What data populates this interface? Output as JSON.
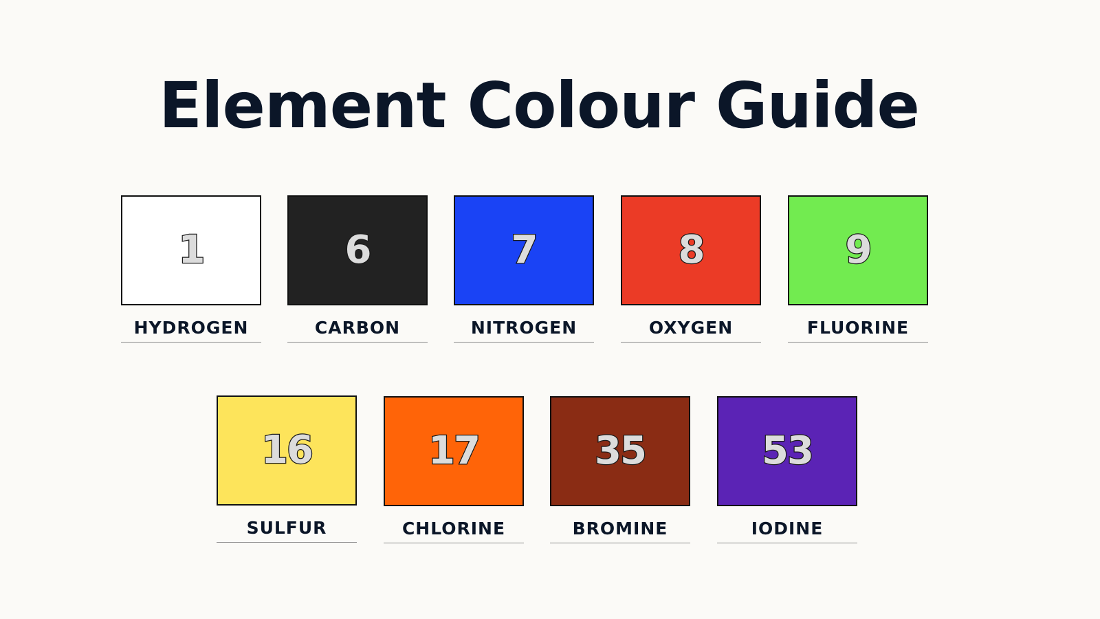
{
  "title": "Element Colour Guide",
  "elements": [
    {
      "number": "1",
      "name": "HYDROGEN",
      "color": "#ffffff"
    },
    {
      "number": "6",
      "name": "CARBON",
      "color": "#222222"
    },
    {
      "number": "7",
      "name": "NITROGEN",
      "color": "#1a43f5"
    },
    {
      "number": "8",
      "name": "OXYGEN",
      "color": "#eb3b26"
    },
    {
      "number": "9",
      "name": "FLUORINE",
      "color": "#72eb50"
    },
    {
      "number": "16",
      "name": "SULFUR",
      "color": "#fde45b"
    },
    {
      "number": "17",
      "name": "CHLORINE",
      "color": "#ff6408"
    },
    {
      "number": "35",
      "name": "BROMINE",
      "color": "#8a2c14"
    },
    {
      "number": "53",
      "name": "IODINE",
      "color": "#5b23b5"
    }
  ]
}
